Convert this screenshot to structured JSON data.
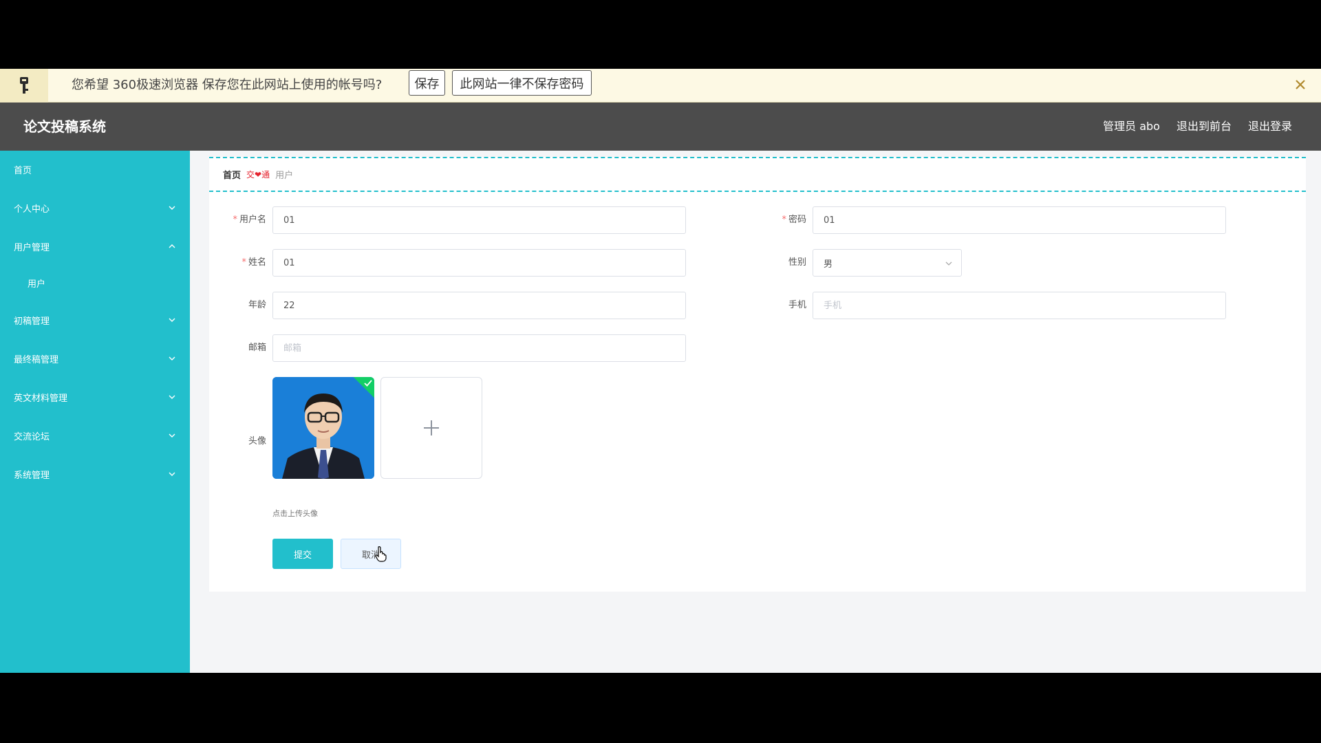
{
  "password_bar": {
    "message": "您希望 360极速浏览器 保存您在此网站上使用的帐号吗?",
    "save_label": "保存",
    "never_label": "此网站一律不保存密码"
  },
  "header": {
    "brand": "论文投稿系统",
    "nav": [
      "管理员 abo",
      "退出到前台",
      "退出登录"
    ]
  },
  "sidebar": {
    "items": [
      {
        "label": "首页"
      },
      {
        "label": "个人中心"
      },
      {
        "label": "用户管理"
      },
      {
        "label": "用户"
      },
      {
        "label": "初稿管理"
      },
      {
        "label": "最终稿管理"
      },
      {
        "label": "英文材料管理"
      },
      {
        "label": "交流论坛"
      },
      {
        "label": "系统管理"
      }
    ]
  },
  "breadcrumb": {
    "home": "首页",
    "separator": "交❤通",
    "current": "用户"
  },
  "form": {
    "username": {
      "label": "用户名",
      "value": "01"
    },
    "password": {
      "label": "密码",
      "value": "01"
    },
    "name": {
      "label": "姓名",
      "value": "01"
    },
    "gender": {
      "label": "性别",
      "value": "男"
    },
    "age": {
      "label": "年龄",
      "value": "22"
    },
    "phone": {
      "label": "手机",
      "placeholder": "手机"
    },
    "email": {
      "label": "邮箱",
      "placeholder": "邮箱"
    },
    "avatar": {
      "label": "头像",
      "hint": "点击上传头像"
    },
    "submit_label": "提交",
    "cancel_label": "取消"
  },
  "colors": {
    "accent": "#22bfcc",
    "header_bg": "#4c4c4c",
    "required": "#f56c6c",
    "success_badge": "#13ce66"
  },
  "icons": {
    "key": "key-icon",
    "close": "close-icon",
    "chevron_down": "chevron-down-icon",
    "chevron_up": "chevron-up-icon",
    "plus": "plus-icon",
    "check": "check-icon"
  }
}
